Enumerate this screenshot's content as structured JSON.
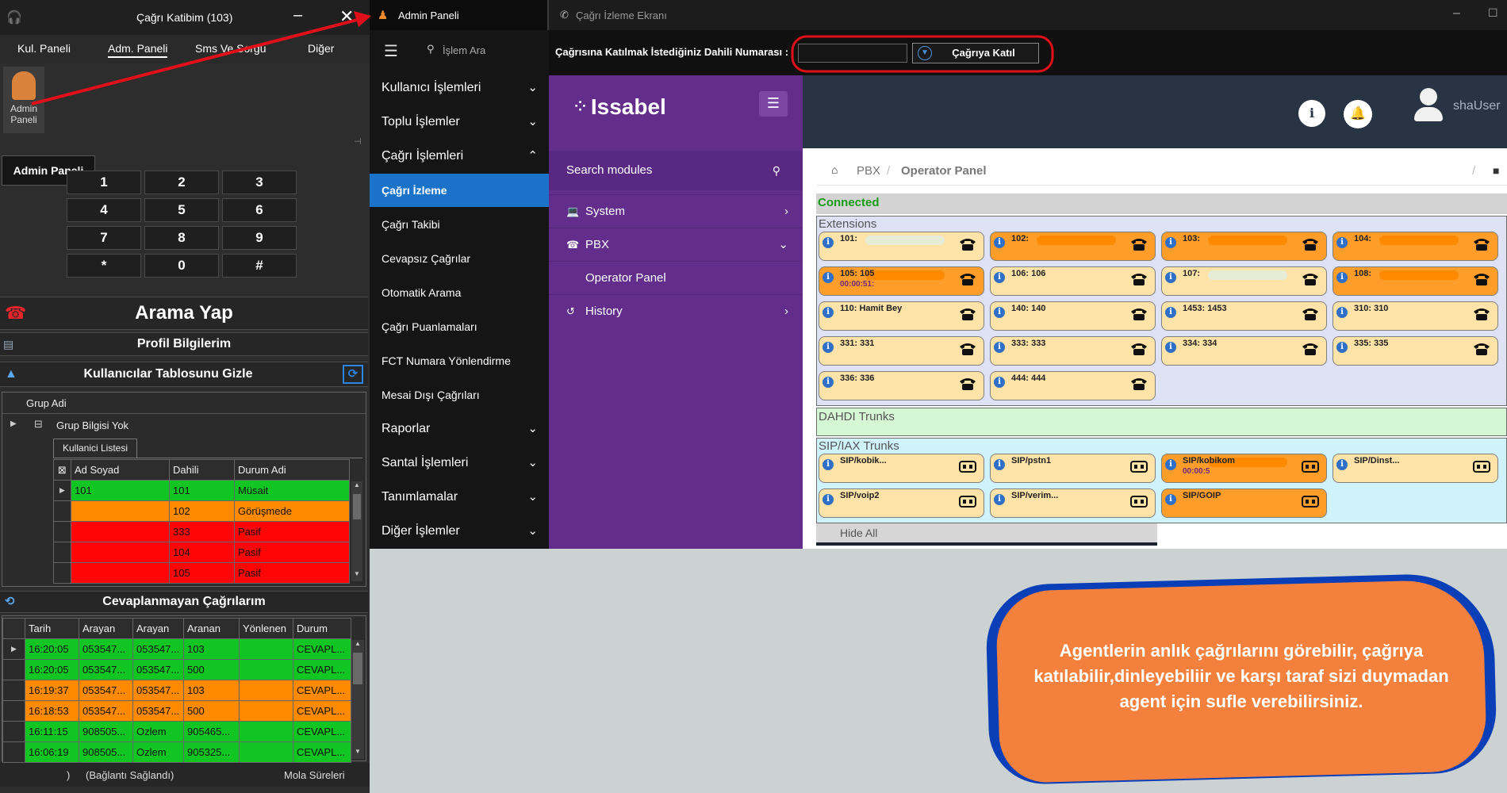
{
  "phone": {
    "title": "Çağrı Katibim (103)",
    "menu": [
      "Kul. Paneli",
      "Adm. Paneli",
      "Sms Ve Sorgu",
      "Diğer"
    ],
    "admin_icon_label": "Admin\nPaneli",
    "tooltip": "Admin Paneli",
    "keypad": [
      "1",
      "2",
      "3",
      "4",
      "5",
      "6",
      "7",
      "8",
      "9",
      "*",
      "0",
      "#"
    ],
    "call_button": "Arama Yap",
    "profile": "Profil Bilgilerim",
    "users_toggle": "Kullanıcılar Tablosunu Gizle",
    "group_header": "Grup Adi",
    "group_row": "Grup Bilgisi Yok",
    "user_list_tab": "Kullanici Listesi",
    "user_columns": [
      "Ad Soyad",
      "Dahili",
      "Durum Adi"
    ],
    "users": [
      {
        "name": "101",
        "ext": "101",
        "status": "Müsait",
        "color": "g"
      },
      {
        "name": "",
        "ext": "102",
        "status": "Görüşmede",
        "color": "o"
      },
      {
        "name": "",
        "ext": "333",
        "status": "Pasif",
        "color": "r"
      },
      {
        "name": "",
        "ext": "104",
        "status": "Pasif",
        "color": "r"
      },
      {
        "name": "",
        "ext": "105",
        "status": "Pasif",
        "color": "r"
      }
    ],
    "missed_title": "Cevaplanmayan Çağrılarım",
    "missed_columns": [
      "Tarih",
      "Arayan",
      "Arayan",
      "Aranan",
      "Yönlenen",
      "Durum"
    ],
    "missed": [
      {
        "cells": [
          "16:20:05",
          "053547...",
          "053547...",
          "103",
          "",
          "CEVAPL..."
        ],
        "color": "g"
      },
      {
        "cells": [
          "16:20:05",
          "053547...",
          "053547...",
          "500",
          "",
          "CEVAPL..."
        ],
        "color": "g"
      },
      {
        "cells": [
          "16:19:37",
          "053547...",
          "053547...",
          "103",
          "",
          "CEVAPL..."
        ],
        "color": "o"
      },
      {
        "cells": [
          "16:18:53",
          "053547...",
          "053547...",
          "500",
          "",
          "CEVAPL..."
        ],
        "color": "o"
      },
      {
        "cells": [
          "16:11:15",
          "908505...",
          "Ozlem",
          "905465...",
          "",
          "CEVAPL..."
        ],
        "color": "g"
      },
      {
        "cells": [
          "16:06:19",
          "908505...",
          "Ozlem",
          "905325...",
          "",
          "CEVAPL..."
        ],
        "color": "g"
      }
    ],
    "status_left": ")",
    "status_mid": "(Bağlantı Sağlandı)",
    "status_right": "Mola Süreleri"
  },
  "admin": {
    "title": "Admin Paneli",
    "search": "İşlem Ara",
    "items": [
      {
        "label": "Kullanıcı İşlemleri",
        "chev": "⌄",
        "small": false,
        "sel": false
      },
      {
        "label": "Toplu İşlemler",
        "chev": "⌄",
        "small": false,
        "sel": false
      },
      {
        "label": "Çağrı İşlemleri",
        "chev": "⌃",
        "small": false,
        "sel": false
      },
      {
        "label": "Çağrı İzleme",
        "chev": "",
        "small": true,
        "sel": true
      },
      {
        "label": "Çağrı Takibi",
        "chev": "",
        "small": true,
        "sel": false
      },
      {
        "label": "Cevapsız Çağrılar",
        "chev": "",
        "small": true,
        "sel": false
      },
      {
        "label": "Otomatik Arama",
        "chev": "",
        "small": true,
        "sel": false
      },
      {
        "label": "Çağrı Puanlamaları",
        "chev": "",
        "small": true,
        "sel": false
      },
      {
        "label": "FCT Numara Yönlendirme",
        "chev": "",
        "small": true,
        "sel": false
      },
      {
        "label": "Mesai Dışı Çağrıları",
        "chev": "",
        "small": true,
        "sel": false
      },
      {
        "label": "Raporlar",
        "chev": "⌄",
        "small": false,
        "sel": false
      },
      {
        "label": "Santal İşlemleri",
        "chev": "⌄",
        "small": false,
        "sel": false
      },
      {
        "label": "Tanımlamalar",
        "chev": "⌄",
        "small": false,
        "sel": false
      },
      {
        "label": "Diğer İşlemler",
        "chev": "⌄",
        "small": false,
        "sel": false
      }
    ]
  },
  "monitor": {
    "title": "Çağrı İzleme Ekranı",
    "join_label": "Çağrısına Katılmak İstediğiniz Dahili Numarası :",
    "join_value": "",
    "join_button": "Çağrıya Katıl",
    "brand": "Issabel",
    "search_modules": "Search modules",
    "side": [
      {
        "label": "System",
        "icon": "💻",
        "chev": "›",
        "indent": false
      },
      {
        "label": "PBX",
        "icon": "☎",
        "chev": "⌄",
        "indent": false
      },
      {
        "label": "Operator Panel",
        "icon": "",
        "chev": "",
        "indent": true
      },
      {
        "label": "History",
        "icon": "↺",
        "chev": "›",
        "indent": false
      }
    ],
    "user": "shaUser",
    "crumb_root": "PBX",
    "crumb_page": "Operator Panel",
    "connected": "Connected",
    "extensions_title": "Extensions",
    "extensions": [
      {
        "label": "101:",
        "time": "",
        "busy": false,
        "blur": true
      },
      {
        "label": "102:",
        "time": "",
        "busy": true,
        "blur": true
      },
      {
        "label": "103:",
        "time": "",
        "busy": true,
        "blur": true
      },
      {
        "label": "104:",
        "time": "",
        "busy": true,
        "blur": true
      },
      {
        "label": "105: 105",
        "time": "00:00:51:",
        "busy": true,
        "blur": true
      },
      {
        "label": "106: 106",
        "time": "",
        "busy": false,
        "blur": false
      },
      {
        "label": "107:",
        "time": "",
        "busy": false,
        "blur": true
      },
      {
        "label": "108:",
        "time": "",
        "busy": true,
        "blur": true
      },
      {
        "label": "110: Hamit Bey",
        "time": "",
        "busy": false,
        "blur": false
      },
      {
        "label": "140: 140",
        "time": "",
        "busy": false,
        "blur": false
      },
      {
        "label": "1453: 1453",
        "time": "",
        "busy": false,
        "blur": false
      },
      {
        "label": "310: 310",
        "time": "",
        "busy": false,
        "blur": false
      },
      {
        "label": "331: 331",
        "time": "",
        "busy": false,
        "blur": false
      },
      {
        "label": "333: 333",
        "time": "",
        "busy": false,
        "blur": false
      },
      {
        "label": "334: 334",
        "time": "",
        "busy": false,
        "blur": false
      },
      {
        "label": "335: 335",
        "time": "",
        "busy": false,
        "blur": false
      },
      {
        "label": "336: 336",
        "time": "",
        "busy": false,
        "blur": false
      },
      {
        "label": "444: 444",
        "time": "",
        "busy": false,
        "blur": false
      }
    ],
    "dahdi_title": "DAHDI Trunks",
    "sip_title": "SIP/IAX Trunks",
    "trunks": [
      {
        "label": "SIP/kobik...",
        "time": "",
        "busy": false,
        "blur": false
      },
      {
        "label": "SIP/pstn1",
        "time": "",
        "busy": false,
        "blur": false
      },
      {
        "label": "SIP/kobikom",
        "time": "00:00:5",
        "busy": true,
        "blur": true
      },
      {
        "label": "SIP/Dinst...",
        "time": "",
        "busy": false,
        "blur": false
      },
      {
        "label": "SIP/voip2",
        "time": "",
        "busy": false,
        "blur": false
      },
      {
        "label": "SIP/verim...",
        "time": "",
        "busy": false,
        "blur": false
      },
      {
        "label": "SIP/GOIP",
        "time": "",
        "busy": true,
        "blur": false
      }
    ],
    "hide_all": "Hide All"
  },
  "callout": "Agentlerin anlık çağrılarını görebilir, çağrıya katılabilir,dinleyebiliir ve karşı taraf sizi duymadan agent için sufle verebilirsiniz.",
  "colors": {
    "accent_blue": "#1a73c9",
    "issabel_purple": "#632d8b",
    "annotation_red": "#e0101a",
    "callout_orange": "#f3813d"
  }
}
